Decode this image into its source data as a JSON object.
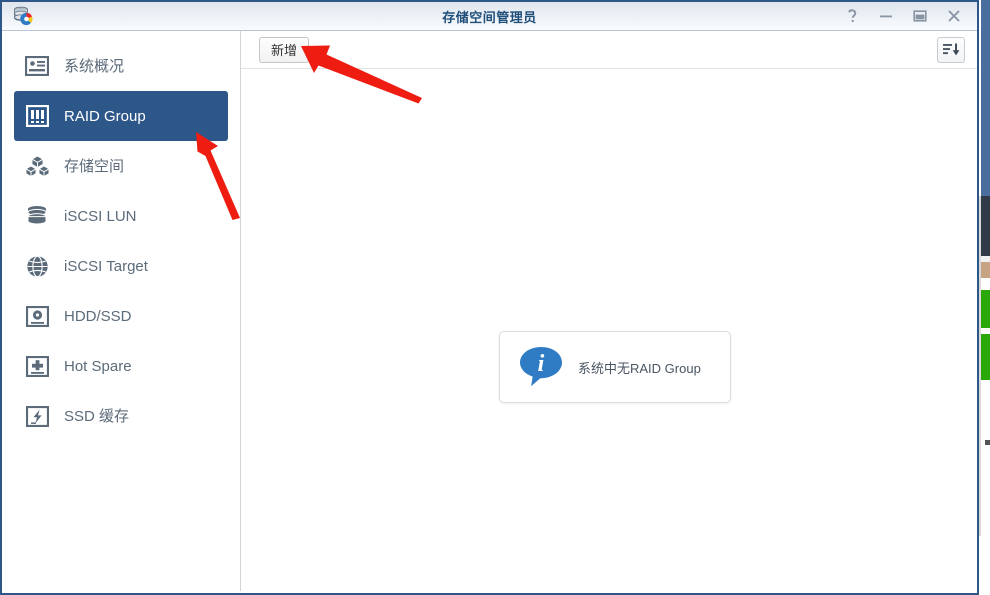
{
  "window": {
    "title": "存储空间管理员",
    "app_icon": "storage-manager-icon",
    "controls": {
      "help_label": "?",
      "minimize_label": "—",
      "maximize_label": "□",
      "close_label": "×"
    }
  },
  "sidebar": {
    "items": [
      {
        "label": "系统概况",
        "icon": "system-overview-icon",
        "selected": false
      },
      {
        "label": "RAID Group",
        "icon": "raid-group-icon",
        "selected": true
      },
      {
        "label": "存储空间",
        "icon": "storage-volume-icon",
        "selected": false
      },
      {
        "label": "iSCSI LUN",
        "icon": "database-icon",
        "selected": false
      },
      {
        "label": "iSCSI Target",
        "icon": "globe-icon",
        "selected": false
      },
      {
        "label": "HDD/SSD",
        "icon": "hard-disk-icon",
        "selected": false
      },
      {
        "label": "Hot Spare",
        "icon": "hot-spare-icon",
        "selected": false
      },
      {
        "label": "SSD 缓存",
        "icon": "ssd-cache-icon",
        "selected": false
      }
    ]
  },
  "toolbar": {
    "new_label": "新增",
    "sort_icon": "sort-descending-icon"
  },
  "main": {
    "empty_state": {
      "icon": "info-icon",
      "message": "系统中无RAID Group"
    }
  },
  "annotations": {
    "arrow_color": "#ee1c11",
    "arrows": [
      {
        "name": "arrow-to-raid-group",
        "points_at": "RAID Group"
      },
      {
        "name": "arrow-to-new-button",
        "points_at": "新增"
      }
    ]
  },
  "theme": {
    "selection_blue": "#2d5689",
    "window_border": "#2d5689",
    "title_text": "#1f4e79",
    "sidebar_text": "#5c6b7a",
    "info_blue": "#2f7cc4"
  }
}
